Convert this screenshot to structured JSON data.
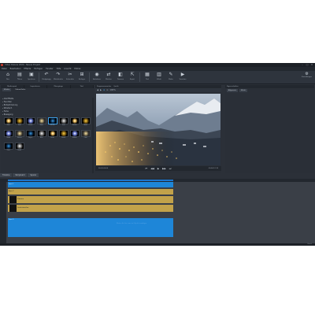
{
  "window": {
    "title": "Video Deluxe 2024 - Neues Projekt",
    "controls": [
      "–",
      "□",
      "✕"
    ]
  },
  "menu": [
    "Datei",
    "Bearbeiten",
    "Effekte",
    "Einfügen",
    "Fenster",
    "Hilfe",
    "Ansicht",
    "Extras"
  ],
  "toolbar": {
    "buttons": [
      {
        "icon": "⌂",
        "label": "Neu"
      },
      {
        "icon": "▤",
        "label": "Öffnen"
      },
      {
        "icon": "▣",
        "label": "Speichern"
      },
      {
        "icon": "↶",
        "label": "Rückgängig"
      },
      {
        "icon": "↷",
        "label": "Wiederholen"
      },
      {
        "icon": "✂",
        "label": "Schneiden"
      },
      {
        "icon": "⊞",
        "label": "Einfügen"
      },
      {
        "icon": "◉",
        "label": "Aufnahme"
      },
      {
        "icon": "⇄",
        "label": "Mischen"
      },
      {
        "icon": "◧",
        "label": "Trimmen"
      },
      {
        "icon": "⇱",
        "label": "Export"
      },
      {
        "icon": "▦",
        "label": "Titel"
      },
      {
        "icon": "▥",
        "label": "Effekt"
      },
      {
        "icon": "✎",
        "label": "Malen"
      },
      {
        "icon": "▶",
        "label": "Vorschau"
      }
    ],
    "right_button": {
      "icon": "⚙",
      "label": "Einstellungen"
    }
  },
  "left_panel": {
    "tabs": [
      "Medienpool",
      "Importieren",
      "Übergänge",
      "Titel"
    ],
    "subtabs": [
      "Effekte",
      "Videoeffekte"
    ],
    "tree": [
      "Alle Effekte",
      "Favoriten",
      "Bildoptimierung",
      "Stilistisch",
      "Farbe",
      "Bewegung"
    ],
    "thumbnails": [
      {
        "label": "Flare"
      },
      {
        "label": "Gold"
      },
      {
        "label": "Sterne"
      },
      {
        "label": "Glanz"
      },
      {
        "label": "Partikel"
      },
      {
        "label": "Licht"
      },
      {
        "label": "Funken"
      },
      {
        "label": "Nebel"
      },
      {
        "label": "Staub"
      },
      {
        "label": "Schnee"
      },
      {
        "label": "Regen"
      },
      {
        "label": "Blitz"
      },
      {
        "label": "Feuer"
      },
      {
        "label": "Rauch"
      },
      {
        "label": "Glühen"
      },
      {
        "label": "Orbit"
      },
      {
        "label": "Kreis"
      },
      {
        "label": "Strahl"
      }
    ]
  },
  "preview": {
    "tabs": [
      "Programmmonitor",
      "Quelle"
    ],
    "tools": [
      "◀",
      "▶",
      "⊕",
      "⊖",
      "100%"
    ],
    "transport": [
      "⏮",
      "◀◀",
      "▶",
      "▶▶",
      "⏭"
    ],
    "timecode_left": "00:00:00:00",
    "timecode_right": "00:00:12:15"
  },
  "properties": {
    "header": "Eigenschaften",
    "tabs": [
      "Allgemein",
      "Effekt"
    ],
    "rows": [
      "Farbe",
      "Deckkraft",
      "Größe",
      "Position",
      "Rotation",
      "Weichzeichnen",
      "Transparenz"
    ]
  },
  "timeline": {
    "tabs": [
      "Timeline",
      "Storyboard",
      "Spuren"
    ],
    "tracks": [
      {
        "type": "blue",
        "label": "Spur 1"
      },
      {
        "type": "yellow",
        "label": "Spur 2"
      },
      {
        "type": "yellow",
        "label": "Flamme"
      },
      {
        "type": "yellow",
        "label": "Leuchtstreifen"
      },
      {
        "type": "blue",
        "label": "Spur 5"
      }
    ],
    "center_text": "Klicken Sie hier, um ein Objekt einzufügen"
  },
  "status": {
    "text": "Bereit"
  },
  "colors": {
    "accent": "#1e86d8",
    "panel": "#2a2f37",
    "clip_yellow": "#c2a24a"
  }
}
